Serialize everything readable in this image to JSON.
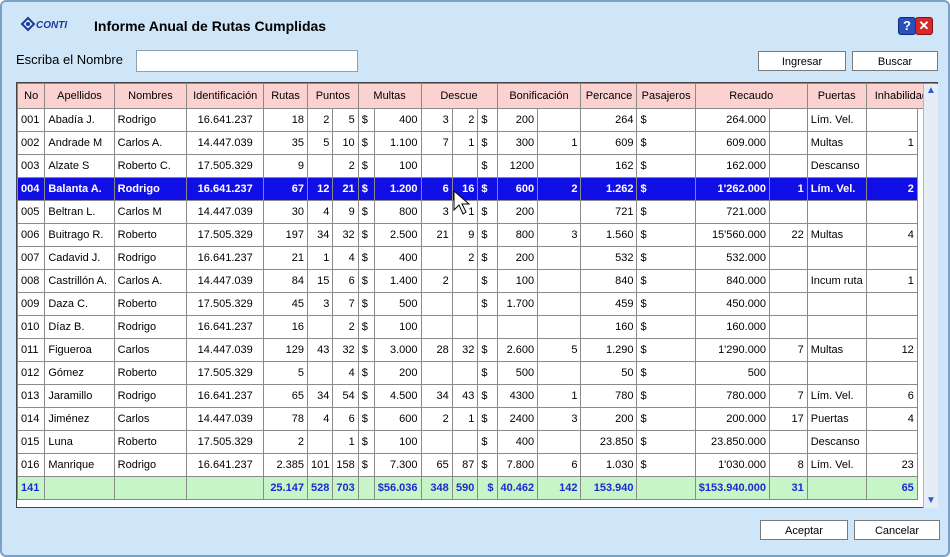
{
  "window": {
    "title": "Informe Anual de Rutas Cumplidas",
    "logo_text": "CONTI"
  },
  "form": {
    "name_label": "Escriba el Nombre",
    "name_value": ""
  },
  "buttons": {
    "ingresar": "Ingresar",
    "buscar": "Buscar",
    "aceptar": "Aceptar",
    "cancelar": "Cancelar",
    "help": "?",
    "close": "✕"
  },
  "table": {
    "headers": [
      "No",
      "Apellidos",
      "Nombres",
      "Identificación",
      "Rutas",
      "Puntos",
      "Multas",
      "Descue",
      "Bonificación",
      "Percance",
      "Pasajeros",
      "Recaudo",
      "Puertas",
      "Inhabilidad"
    ],
    "selected_row": 3,
    "rows": [
      [
        "001",
        "Abadía J.",
        "Rodrigo",
        "16.641.237",
        "18",
        "2",
        "5",
        "$",
        "400",
        "3",
        "2",
        "$",
        "200",
        "",
        "264",
        "$",
        "264.000",
        "",
        "Lím. Vel.",
        ""
      ],
      [
        "002",
        "Andrade M",
        "Carlos A.",
        "14.447.039",
        "35",
        "5",
        "10",
        "$",
        "1.100",
        "7",
        "1",
        "$",
        "300",
        "1",
        "609",
        "$",
        "609.000",
        "",
        "Multas",
        "1"
      ],
      [
        "003",
        "Alzate S",
        "Roberto C.",
        "17.505.329",
        "9",
        "",
        "2",
        "$",
        "100",
        "",
        "",
        "$",
        "1200",
        "",
        "162",
        "$",
        "162.000",
        "",
        "Descanso",
        ""
      ],
      [
        "004",
        "Balanta A.",
        "Rodrigo",
        "16.641.237",
        "67",
        "12",
        "21",
        "$",
        "1.200",
        "6",
        "16",
        "$",
        "600",
        "2",
        "1.262",
        "$",
        "1'262.000",
        "1",
        "Lím. Vel.",
        "2"
      ],
      [
        "005",
        "Beltran L.",
        "Carlos M",
        "14.447.039",
        "30",
        "4",
        "9",
        "$",
        "800",
        "3",
        "1",
        "$",
        "200",
        "",
        "721",
        "$",
        "721.000",
        "",
        "",
        ""
      ],
      [
        "006",
        "Buitrago R.",
        "Roberto",
        "17.505.329",
        "197",
        "34",
        "32",
        "$",
        "2.500",
        "21",
        "9",
        "$",
        "800",
        "3",
        "1.560",
        "$",
        "15'560.000",
        "22",
        "Multas",
        "4"
      ],
      [
        "007",
        "Cadavid J.",
        "Rodrigo",
        "16.641.237",
        "21",
        "1",
        "4",
        "$",
        "400",
        "",
        "2",
        "$",
        "200",
        "",
        "532",
        "$",
        "532.000",
        "",
        "",
        ""
      ],
      [
        "008",
        "Castrillón A.",
        "Carlos A.",
        "14.447.039",
        "84",
        "15",
        "6",
        "$",
        "1.400",
        "2",
        "",
        "$",
        "100",
        "",
        "840",
        "$",
        "840.000",
        "",
        "Incum ruta",
        "1"
      ],
      [
        "009",
        "Daza C.",
        "Roberto",
        "17.505.329",
        "45",
        "3",
        "7",
        "$",
        "500",
        "",
        "",
        "$",
        "1.700",
        "",
        "459",
        "$",
        "450.000",
        "",
        "",
        ""
      ],
      [
        "010",
        "Díaz B.",
        "Rodrigo",
        "16.641.237",
        "16",
        "",
        "2",
        "$",
        "100",
        "",
        "",
        "",
        "",
        "",
        "160",
        "$",
        "160.000",
        "",
        "",
        ""
      ],
      [
        "011",
        "Figueroa",
        "Carlos",
        "14.447.039",
        "129",
        "43",
        "32",
        "$",
        "3.000",
        "28",
        "32",
        "$",
        "2.600",
        "5",
        "1.290",
        "$",
        "1'290.000",
        "7",
        "Multas",
        "12"
      ],
      [
        "012",
        "Gómez",
        "Roberto",
        "17.505.329",
        "5",
        "",
        "4",
        "$",
        "200",
        "",
        "",
        "$",
        "500",
        "",
        "50",
        "$",
        "500",
        "",
        "",
        ""
      ],
      [
        "013",
        "Jaramillo",
        "Rodrigo",
        "16.641.237",
        "65",
        "34",
        "54",
        "$",
        "4.500",
        "34",
        "43",
        "$",
        "4300",
        "1",
        "780",
        "$",
        "780.000",
        "7",
        "Lím. Vel.",
        "6"
      ],
      [
        "014",
        "Jiménez",
        "Carlos",
        "14.447.039",
        "78",
        "4",
        "6",
        "$",
        "600",
        "2",
        "1",
        "$",
        "2400",
        "3",
        "200",
        "$",
        "200.000",
        "17",
        "Puertas",
        "4"
      ],
      [
        "015",
        "Luna",
        "Roberto",
        "17.505.329",
        "2",
        "",
        "1",
        "$",
        "100",
        "",
        "",
        "$",
        "400",
        "",
        "23.850",
        "$",
        "23.850.000",
        "",
        "Descanso",
        ""
      ],
      [
        "016",
        "Manrique",
        "Rodrigo",
        "16.641.237",
        "2.385",
        "101",
        "158",
        "$",
        "7.300",
        "65",
        "87",
        "$",
        "7.800",
        "6",
        "1.030",
        "$",
        "1'030.000",
        "8",
        "Lím. Vel.",
        "23"
      ]
    ],
    "totals": [
      "141",
      "",
      "",
      "",
      "25.147",
      "528",
      "703",
      "",
      "$56.036",
      "348",
      "590",
      "$",
      "40.462",
      "142",
      "153.940",
      "",
      "$153.940.000",
      "31",
      "",
      "65"
    ]
  }
}
